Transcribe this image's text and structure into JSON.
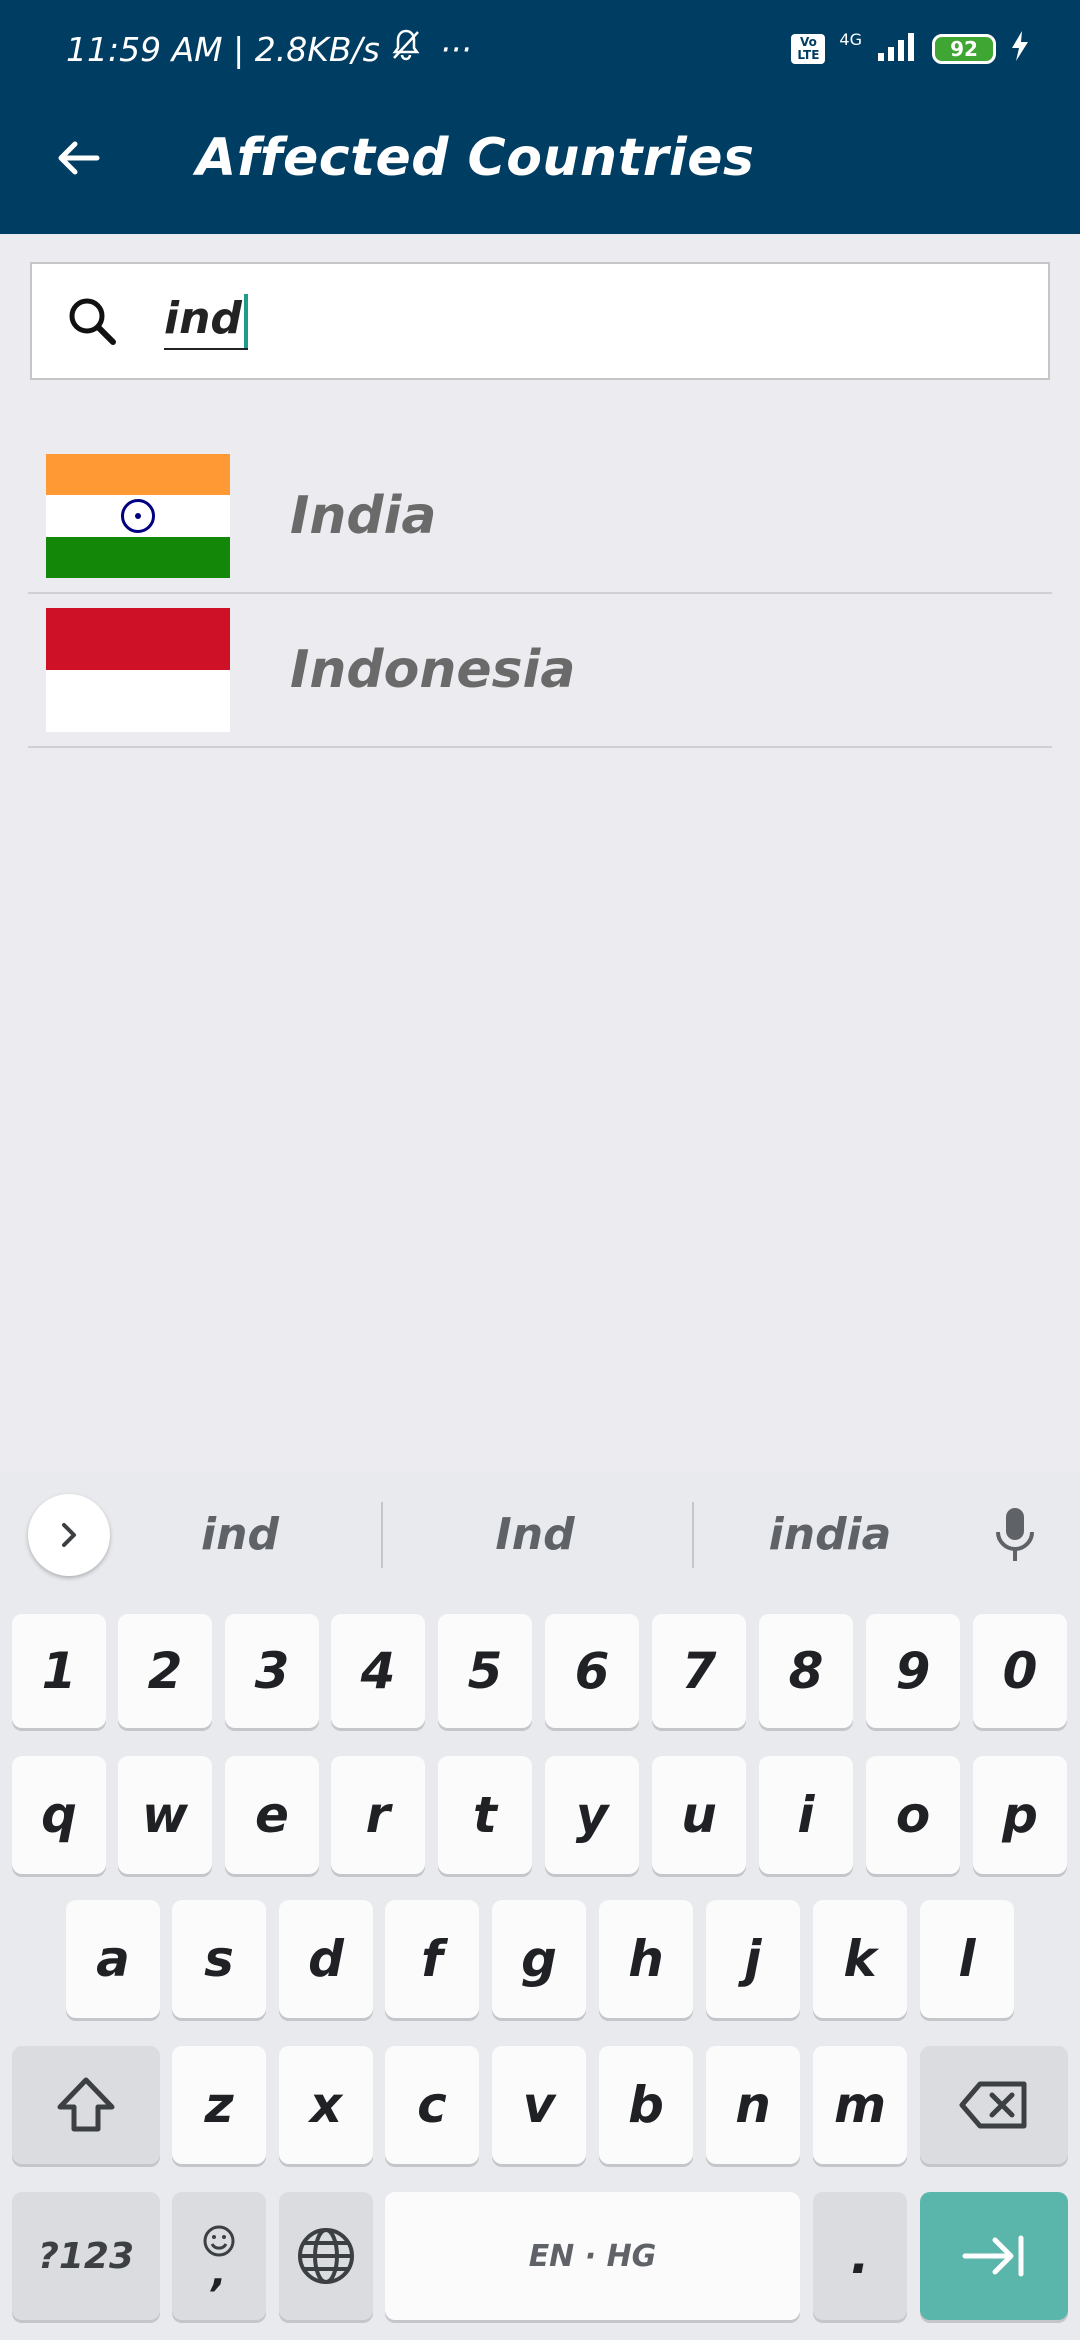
{
  "status_bar": {
    "time_speed": "11:59 AM | 2.8KB/s",
    "dots": "···",
    "volte_line1": "Vo",
    "volte_line2": "LTE",
    "network": "4G",
    "battery": "92"
  },
  "app_bar": {
    "title": "Affected Countries",
    "back_icon": "arrow-left-icon"
  },
  "search": {
    "value": "ind",
    "icon": "search-icon"
  },
  "countries": [
    {
      "name": "India",
      "flag": "india-flag"
    },
    {
      "name": "Indonesia",
      "flag": "indonesia-flag"
    }
  ],
  "keyboard": {
    "suggestions": [
      "ind",
      "Ind",
      "india"
    ],
    "row_numbers": [
      "1",
      "2",
      "3",
      "4",
      "5",
      "6",
      "7",
      "8",
      "9",
      "0"
    ],
    "row_top": [
      "q",
      "w",
      "e",
      "r",
      "t",
      "y",
      "u",
      "i",
      "o",
      "p"
    ],
    "row_middle": [
      "a",
      "s",
      "d",
      "f",
      "g",
      "h",
      "j",
      "k",
      "l"
    ],
    "row_bottom": [
      "z",
      "x",
      "c",
      "v",
      "b",
      "n",
      "m"
    ],
    "symbols_label": "?123",
    "emoji_comma": ",",
    "space_label": "EN · HG",
    "period": "."
  },
  "colors": {
    "app_bar": "#003d62",
    "background": "#ececf0",
    "enter_key": "#5ab5aa",
    "caret": "#1e9b8a"
  }
}
